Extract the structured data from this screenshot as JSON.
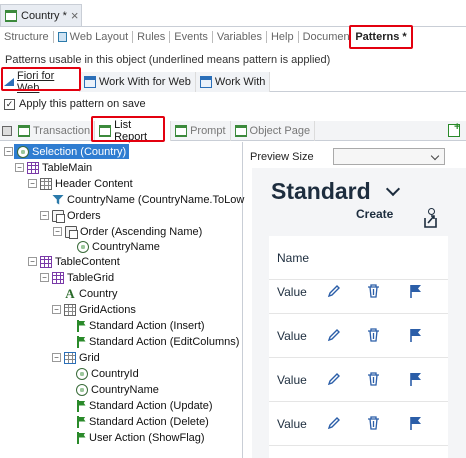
{
  "document_tab": {
    "title": "Country *",
    "close": "×"
  },
  "part_tabs": [
    "Structure",
    "Web Layout",
    "Rules",
    "Events",
    "Variables",
    "Help",
    "Documentation",
    "Patterns *"
  ],
  "description": "Patterns usable in this object (underlined means pattern is applied)",
  "pattern_tabs": [
    "Fiori for Web",
    "Work With for Web",
    "Work With"
  ],
  "apply_on_save": {
    "label": "Apply this pattern on save",
    "checked": true
  },
  "sub_tabs": [
    "Transaction",
    "List Report",
    "Prompt",
    "Object Page"
  ],
  "tree": [
    "Selection (Country)",
    "TableMain",
    "Header Content",
    "CountryName (CountryName.ToLow",
    "Orders",
    "Order (Ascending Name)",
    "CountryName",
    "TableContent",
    "TableGrid",
    "Country",
    "GridActions",
    "Standard Action (Insert)",
    "Standard Action (EditColumns)",
    "Grid",
    "CountryId",
    "CountryName",
    "Standard Action (Update)",
    "Standard Action (Delete)",
    "User Action (ShowFlag)"
  ],
  "preview": {
    "size_label": "Preview Size",
    "size_value": "",
    "title": "Standard",
    "create_label": "Create",
    "column_header": "Name",
    "rows": [
      "Value",
      "Value",
      "Value",
      "Value"
    ]
  },
  "colors": {
    "selection": "#2f7dd1",
    "highlight": "#e3000f",
    "accent": "#1d2d3e"
  }
}
